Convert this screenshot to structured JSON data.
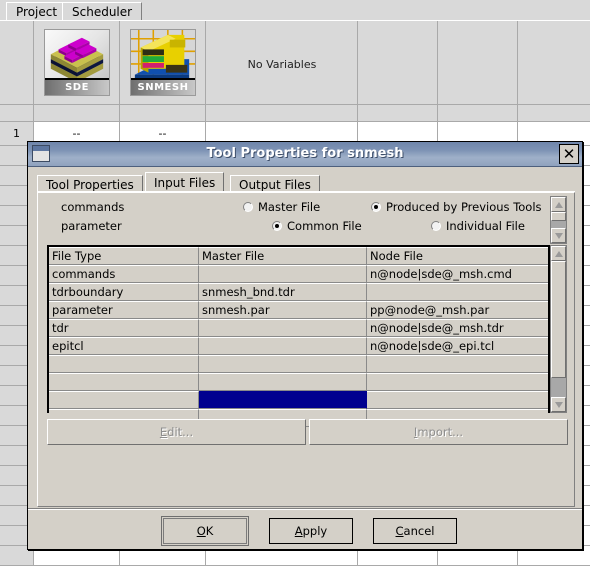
{
  "app": {
    "tabs": [
      {
        "label": "Project",
        "active": true
      },
      {
        "label": "Scheduler",
        "active": false
      }
    ],
    "tools": [
      {
        "name": "SDE",
        "icon": "sde-layers-icon"
      },
      {
        "name": "SNMESH",
        "icon": "snmesh-grid-icon"
      }
    ],
    "variables_text": "No Variables",
    "row_number": "1",
    "row_cells": [
      "--",
      "--"
    ]
  },
  "dialog": {
    "title": "Tool Properties for snmesh",
    "close_label": "✕",
    "tabs": [
      {
        "label": "Tool Properties",
        "active": false
      },
      {
        "label": "Input Files",
        "active": true
      },
      {
        "label": "Output Files",
        "active": false
      }
    ],
    "radio_rows": [
      {
        "label": "commands",
        "options": [
          {
            "label": "Master File",
            "selected": false
          },
          {
            "label": "Produced by Previous Tools",
            "selected": true
          }
        ]
      },
      {
        "label": "parameter",
        "options": [
          {
            "label": "Common File",
            "selected": true
          },
          {
            "label": "Individual File",
            "selected": false
          }
        ]
      }
    ],
    "table": {
      "columns": [
        "File Type",
        "Master File",
        "Node File"
      ],
      "rows": [
        {
          "file_type": "commands",
          "master_file": "",
          "node_file": "n@node|sde@_msh.cmd"
        },
        {
          "file_type": "tdrboundary",
          "master_file": "snmesh_bnd.tdr",
          "node_file": ""
        },
        {
          "file_type": "parameter",
          "master_file": "snmesh.par",
          "node_file": "pp@node@_msh.par"
        },
        {
          "file_type": "tdr",
          "master_file": "",
          "node_file": "n@node|sde@_msh.tdr"
        },
        {
          "file_type": "epitcl",
          "master_file": "",
          "node_file": "n@node|sde@_epi.tcl"
        },
        {
          "file_type": "",
          "master_file": "",
          "node_file": ""
        },
        {
          "file_type": "",
          "master_file": "",
          "node_file": ""
        },
        {
          "file_type": "",
          "master_file": "",
          "node_file": "",
          "selected_cell": "master_file"
        },
        {
          "file_type": "",
          "master_file": "",
          "node_file": ""
        }
      ],
      "selection_color": "#00008f"
    },
    "action_buttons": [
      {
        "label_pre": "",
        "accel": "E",
        "label_post": "dit...",
        "enabled": false,
        "name": "edit-button"
      },
      {
        "label_pre": "",
        "accel": "I",
        "label_post": "mport...",
        "enabled": false,
        "name": "import-button"
      }
    ],
    "footer_buttons": [
      {
        "label_pre": "",
        "accel": "O",
        "label_post": "K",
        "default": true,
        "name": "ok-button"
      },
      {
        "label_pre": "",
        "accel": "A",
        "label_post": "pply",
        "default": false,
        "name": "apply-button"
      },
      {
        "label_pre": "",
        "accel": "C",
        "label_post": "ancel",
        "default": false,
        "name": "cancel-button"
      }
    ]
  }
}
